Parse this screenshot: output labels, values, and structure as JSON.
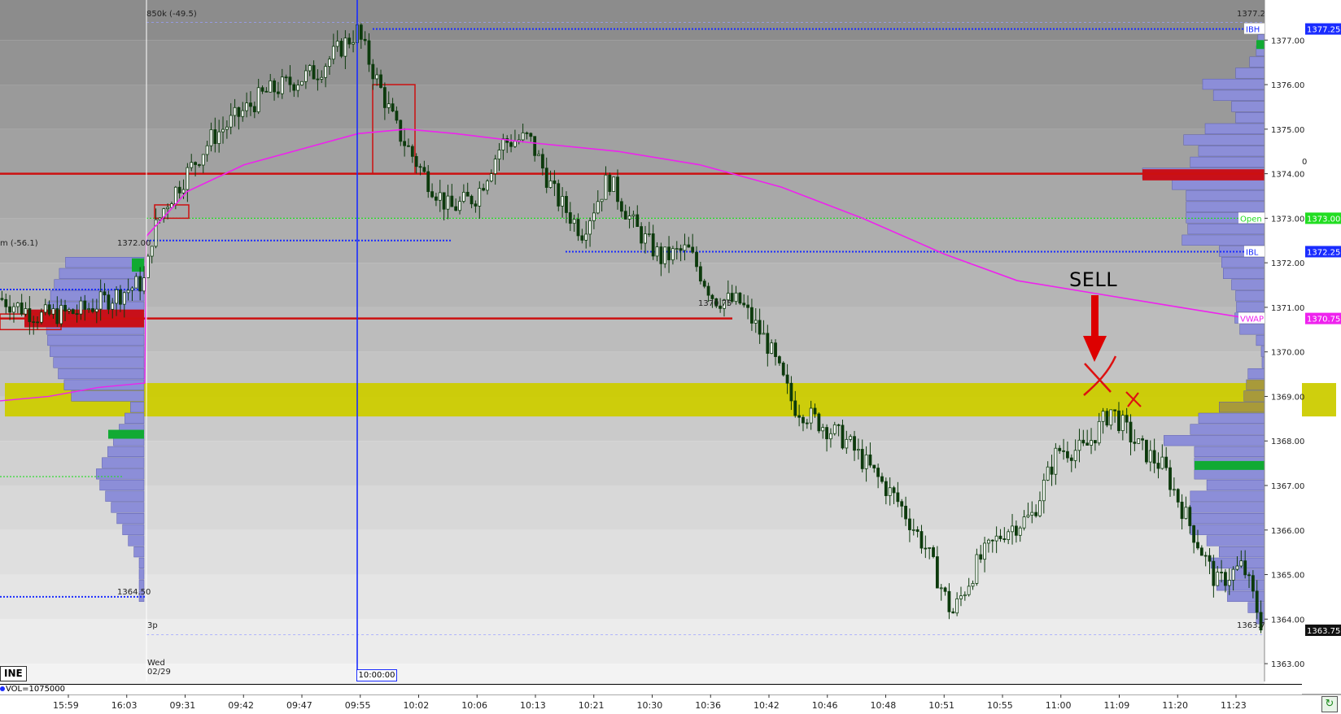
{
  "price_axis": {
    "min": 1362.6,
    "max": 1377.9,
    "ticks": [
      {
        "value": 1377,
        "label": "1377.00"
      },
      {
        "value": 1376,
        "label": "1376.00"
      },
      {
        "value": 1375,
        "label": "1375.00"
      },
      {
        "value": 1374,
        "label": "1374.00"
      },
      {
        "value": 1373,
        "label": "1373.00"
      },
      {
        "value": 1372,
        "label": "1372.00"
      },
      {
        "value": 1371,
        "label": "1371.00"
      },
      {
        "value": 1370,
        "label": "1370.00"
      },
      {
        "value": 1369,
        "label": "1369.00"
      },
      {
        "value": 1368,
        "label": "1368.00"
      },
      {
        "value": 1367,
        "label": "1367.00"
      },
      {
        "value": 1366,
        "label": "1366.00"
      },
      {
        "value": 1365,
        "label": "1365.00"
      },
      {
        "value": 1364,
        "label": "1364.00"
      },
      {
        "value": 1363,
        "label": "1363.00"
      }
    ]
  },
  "time_axis": [
    "15:59",
    "16:03",
    "09:31",
    "09:42",
    "09:47",
    "09:55",
    "10:02",
    "10:06",
    "10:13",
    "10:21",
    "10:30",
    "10:36",
    "10:42",
    "10:46",
    "10:48",
    "10:51",
    "10:55",
    "11:00",
    "11:09",
    "11:20",
    "11:23"
  ],
  "tags": {
    "ibh": {
      "name": "IBH",
      "value": "1377.25",
      "price": 1377.25,
      "color": "#1a2cff"
    },
    "ibl": {
      "name": "IBL",
      "value": "1372.25",
      "price": 1372.25,
      "color": "#1a2cff"
    },
    "open": {
      "name": "Open",
      "value": "1373.00",
      "price": 1373.0,
      "color": "#22dd22"
    },
    "vwap": {
      "name": "VWAP",
      "value": "1370.75",
      "price": 1370.75,
      "color": "#ee22ee"
    },
    "last": {
      "value": "1363.75",
      "price": 1363.75,
      "color": "#111111"
    }
  },
  "annotations": {
    "session_header": "850k (-49.5)",
    "prev_session_header": "m (-56.1)",
    "prev_high_label": "1372.00",
    "prev_low_label": "1364.50",
    "session_high_label": "1377.25",
    "session_low_label": "1363.75",
    "level_1374_label": "1374.00",
    "level_137075_label": "1370.75",
    "session_marker": "3p",
    "sell_text": "SELL"
  },
  "day_label": {
    "dow": "Wed",
    "date": "02/29"
  },
  "time_marker": "10:00:00",
  "mode_tab": "INE",
  "volume_label": "VOL=1075000",
  "colors": {
    "candle": "#0c3a0c",
    "vwap": "#ee22ee",
    "level_red": "#cc1010",
    "ib_blue": "#1a2cff",
    "zone_yellow": "#cccc00",
    "profile": "#8c8ed8",
    "poc_red": "#c8101a",
    "green_bar": "#11aa33"
  },
  "chart_data": {
    "type": "candlestick",
    "x": [
      "15:59",
      "16:03",
      "09:31",
      "09:42",
      "09:47",
      "09:55",
      "10:02",
      "10:06",
      "10:13",
      "10:21",
      "10:30",
      "10:36",
      "10:42",
      "10:46",
      "10:48",
      "10:51",
      "10:55",
      "11:00",
      "11:09",
      "11:20",
      "11:23"
    ],
    "path_anchors": [
      {
        "t": 0,
        "p": 1371.2
      },
      {
        "t": 0.03,
        "p": 1370.8
      },
      {
        "t": 0.06,
        "p": 1370.9
      },
      {
        "t": 0.09,
        "p": 1371.3
      },
      {
        "t": 0.11,
        "p": 1371.6
      },
      {
        "t": 0.115,
        "p": 1372.6
      },
      {
        "t": 0.125,
        "p": 1373.3
      },
      {
        "t": 0.16,
        "p": 1374.8
      },
      {
        "t": 0.2,
        "p": 1375.8
      },
      {
        "t": 0.24,
        "p": 1376.3
      },
      {
        "t": 0.27,
        "p": 1377.2
      },
      {
        "t": 0.3,
        "p": 1375.0
      },
      {
        "t": 0.32,
        "p": 1374.0
      },
      {
        "t": 0.34,
        "p": 1373.2
      },
      {
        "t": 0.36,
        "p": 1373.5
      },
      {
        "t": 0.38,
        "p": 1374.7
      },
      {
        "t": 0.4,
        "p": 1374.8
      },
      {
        "t": 0.42,
        "p": 1373.5
      },
      {
        "t": 0.44,
        "p": 1372.7
      },
      {
        "t": 0.46,
        "p": 1373.9
      },
      {
        "t": 0.48,
        "p": 1372.8
      },
      {
        "t": 0.5,
        "p": 1372.1
      },
      {
        "t": 0.52,
        "p": 1372.3
      },
      {
        "t": 0.54,
        "p": 1371.2
      },
      {
        "t": 0.56,
        "p": 1371.1
      },
      {
        "t": 0.58,
        "p": 1370.2
      },
      {
        "t": 0.6,
        "p": 1368.8
      },
      {
        "t": 0.62,
        "p": 1368.4
      },
      {
        "t": 0.64,
        "p": 1368.0
      },
      {
        "t": 0.66,
        "p": 1367.3
      },
      {
        "t": 0.68,
        "p": 1366.6
      },
      {
        "t": 0.7,
        "p": 1365.6
      },
      {
        "t": 0.72,
        "p": 1364.1
      },
      {
        "t": 0.74,
        "p": 1365.3
      },
      {
        "t": 0.76,
        "p": 1366.0
      },
      {
        "t": 0.78,
        "p": 1366.3
      },
      {
        "t": 0.8,
        "p": 1367.8
      },
      {
        "t": 0.82,
        "p": 1367.8
      },
      {
        "t": 0.84,
        "p": 1368.7
      },
      {
        "t": 0.86,
        "p": 1367.9
      },
      {
        "t": 0.88,
        "p": 1367.4
      },
      {
        "t": 0.9,
        "p": 1366.1
      },
      {
        "t": 0.92,
        "p": 1364.8
      },
      {
        "t": 0.94,
        "p": 1365.2
      },
      {
        "t": 0.955,
        "p": 1363.8
      }
    ],
    "candle_count": 320,
    "reference_levels": [
      {
        "name": "IBH",
        "price": 1377.25
      },
      {
        "name": "IBL",
        "price": 1372.25
      },
      {
        "name": "Open",
        "price": 1373.0
      },
      {
        "name": "VWAP",
        "price": 1370.75
      },
      {
        "name": "level",
        "price": 1374.0
      },
      {
        "name": "level",
        "price": 1370.75
      }
    ],
    "zone": {
      "from": 1368.55,
      "to": 1369.3
    },
    "volume_profile": {
      "prices": [
        1377.0,
        1376.75,
        1376.5,
        1376.25,
        1376.0,
        1375.75,
        1375.5,
        1375.25,
        1375.0,
        1374.75,
        1374.5,
        1374.25,
        1374.0,
        1373.75,
        1373.5,
        1373.25,
        1373.0,
        1372.75,
        1372.5,
        1372.25,
        1372.0,
        1371.75,
        1371.5,
        1371.25,
        1371.0,
        1370.75,
        1370.5,
        1370.25,
        1370.0,
        1369.75,
        1369.5,
        1369.25,
        1369.0,
        1368.75,
        1368.5,
        1368.25,
        1368.0,
        1367.75,
        1367.5,
        1367.25,
        1367.0,
        1366.75,
        1366.5,
        1366.25,
        1366.0,
        1365.75,
        1365.5,
        1365.25,
        1365.0,
        1364.75,
        1364.5,
        1364.25,
        1364.0
      ],
      "volumes": [
        8,
        10,
        18,
        35,
        75,
        62,
        40,
        35,
        72,
        98,
        80,
        90,
        148,
        112,
        95,
        95,
        95,
        93,
        100,
        55,
        52,
        50,
        40,
        35,
        34,
        36,
        30,
        10,
        4,
        3,
        20,
        22,
        25,
        55,
        80,
        90,
        122,
        85,
        85,
        85,
        70,
        90,
        90,
        90,
        90,
        70,
        55,
        65,
        40,
        58,
        45,
        20,
        10
      ]
    }
  }
}
